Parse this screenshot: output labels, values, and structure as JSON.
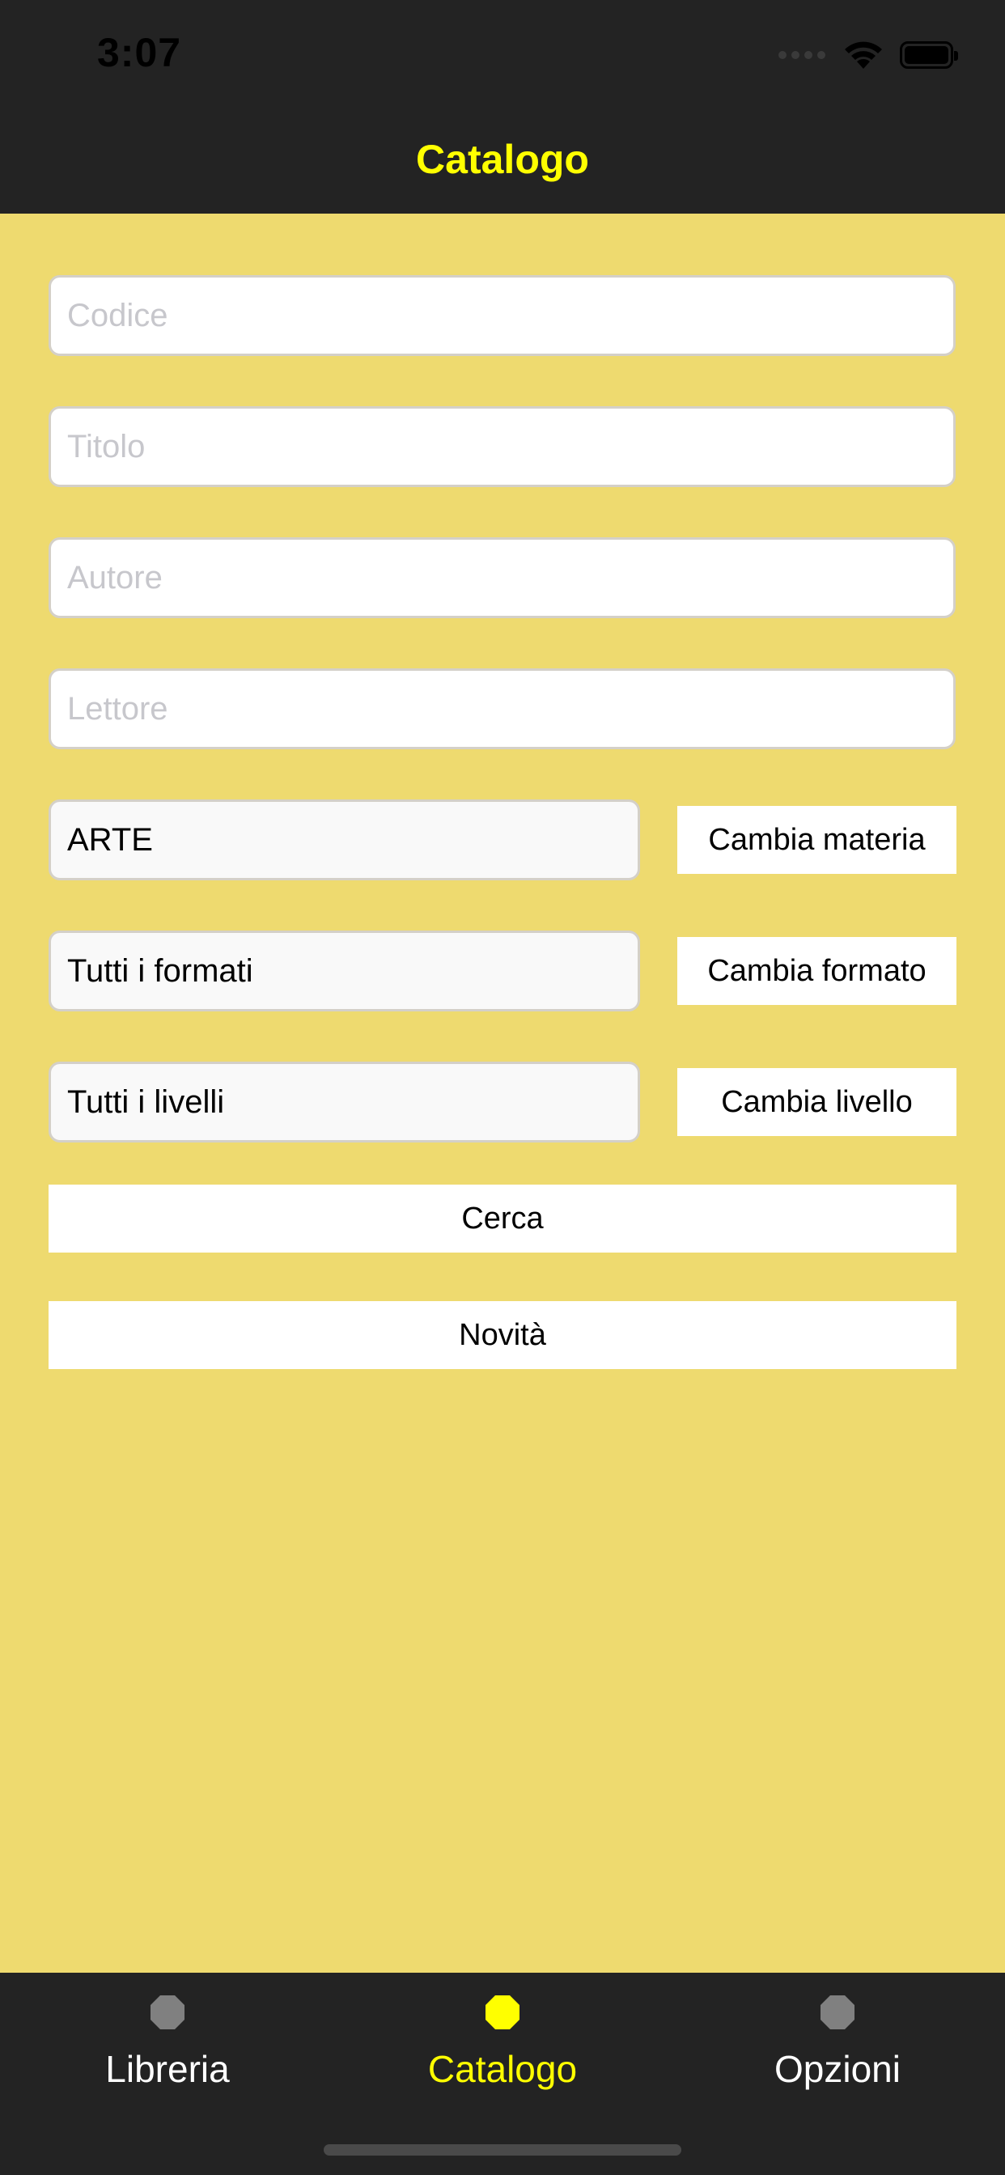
{
  "status_bar": {
    "time": "3:07"
  },
  "nav": {
    "title": "Catalogo"
  },
  "form": {
    "codice_placeholder": "Codice",
    "titolo_placeholder": "Titolo",
    "autore_placeholder": "Autore",
    "lettore_placeholder": "Lettore",
    "materia_value": "ARTE",
    "formato_value": "Tutti i formati",
    "livello_value": "Tutti i livelli",
    "cambia_materia_label": "Cambia materia",
    "cambia_formato_label": "Cambia formato",
    "cambia_livello_label": "Cambia livello",
    "cerca_label": "Cerca",
    "novita_label": "Novità"
  },
  "tabs": [
    {
      "label": "Libreria",
      "icon": "octagon-icon",
      "active": false
    },
    {
      "label": "Catalogo",
      "icon": "octagon-icon",
      "active": true
    },
    {
      "label": "Opzioni",
      "icon": "octagon-icon",
      "active": false
    }
  ],
  "colors": {
    "background": "#EEDA6F",
    "bar": "#232323",
    "accent": "#FFFF00",
    "inactive_icon": "#808080"
  }
}
